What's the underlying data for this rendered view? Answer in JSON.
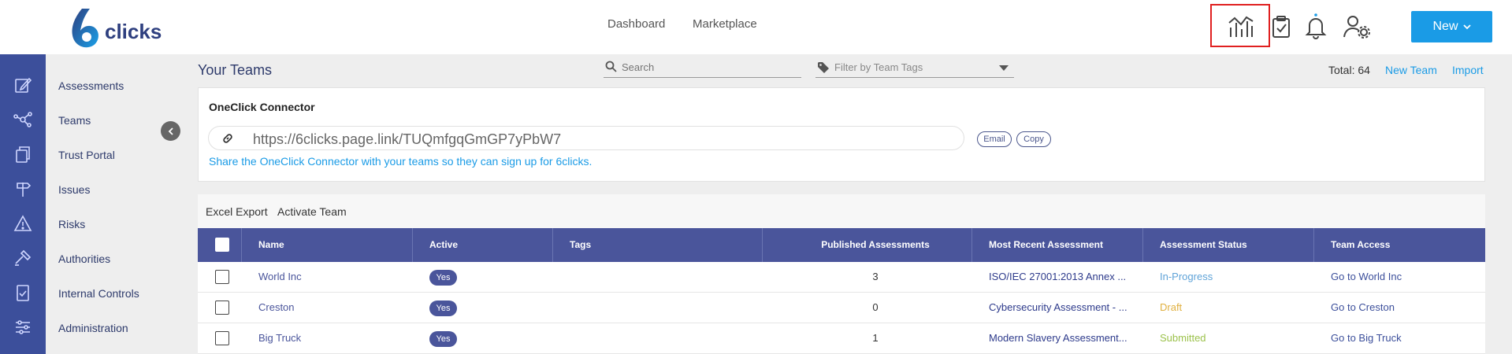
{
  "header": {
    "logo_text": "clicks",
    "nav": [
      {
        "label": "Dashboard"
      },
      {
        "label": "Marketplace"
      }
    ],
    "icons": [
      "analytics-chart-icon",
      "task-checklist-icon",
      "notification-bell-icon",
      "user-settings-icon"
    ],
    "new_button": "New",
    "colors": {
      "accent": "#1a9be6",
      "brand": "#3c4f9b",
      "highlight": "#e02020"
    }
  },
  "sidebar": {
    "items": [
      {
        "label": "Assessments",
        "icon": "edit-icon"
      },
      {
        "label": "Teams",
        "icon": "network-icon"
      },
      {
        "label": "Trust Portal",
        "icon": "documents-icon"
      },
      {
        "label": "Issues",
        "icon": "signpost-icon"
      },
      {
        "label": "Risks",
        "icon": "warning-icon"
      },
      {
        "label": "Authorities",
        "icon": "gavel-icon"
      },
      {
        "label": "Internal Controls",
        "icon": "clipboard-icon"
      },
      {
        "label": "Administration",
        "icon": "sliders-icon"
      }
    ]
  },
  "main": {
    "title": "Your Teams",
    "search_placeholder": "Search",
    "filter_placeholder": "Filter by Team Tags",
    "total": "Total: 64",
    "new_team": "New Team",
    "import": "Import"
  },
  "connector": {
    "title": "OneClick Connector",
    "url": "https://6clicks.page.link/TUQmfgqGmGP7yPbW7",
    "email": "Email",
    "copy": "Copy",
    "note": "Share the OneClick Connector with your teams so they can sign up for 6clicks."
  },
  "table": {
    "actions": [
      "Excel Export",
      "Activate Team"
    ],
    "columns": [
      "Name",
      "Active",
      "Tags",
      "Published Assessments",
      "Most Recent Assessment",
      "Assessment Status",
      "Team Access"
    ],
    "rows": [
      {
        "name": "World Inc",
        "active": "Yes",
        "tags": "",
        "published": "3",
        "recent": "ISO/IEC 27001:2013 Annex ...",
        "status": "In-Progress",
        "status_color": "#5fa3d8",
        "access": "Go to World Inc"
      },
      {
        "name": "Creston",
        "active": "Yes",
        "tags": "",
        "published": "0",
        "recent": "Cybersecurity Assessment - ...",
        "status": "Draft",
        "status_color": "#e0b040",
        "access": "Go to Creston"
      },
      {
        "name": "Big Truck",
        "active": "Yes",
        "tags": "",
        "published": "1",
        "recent": "Modern Slavery Assessment...",
        "status": "Submitted",
        "status_color": "#9cc24c",
        "access": "Go to Big Truck"
      }
    ]
  }
}
